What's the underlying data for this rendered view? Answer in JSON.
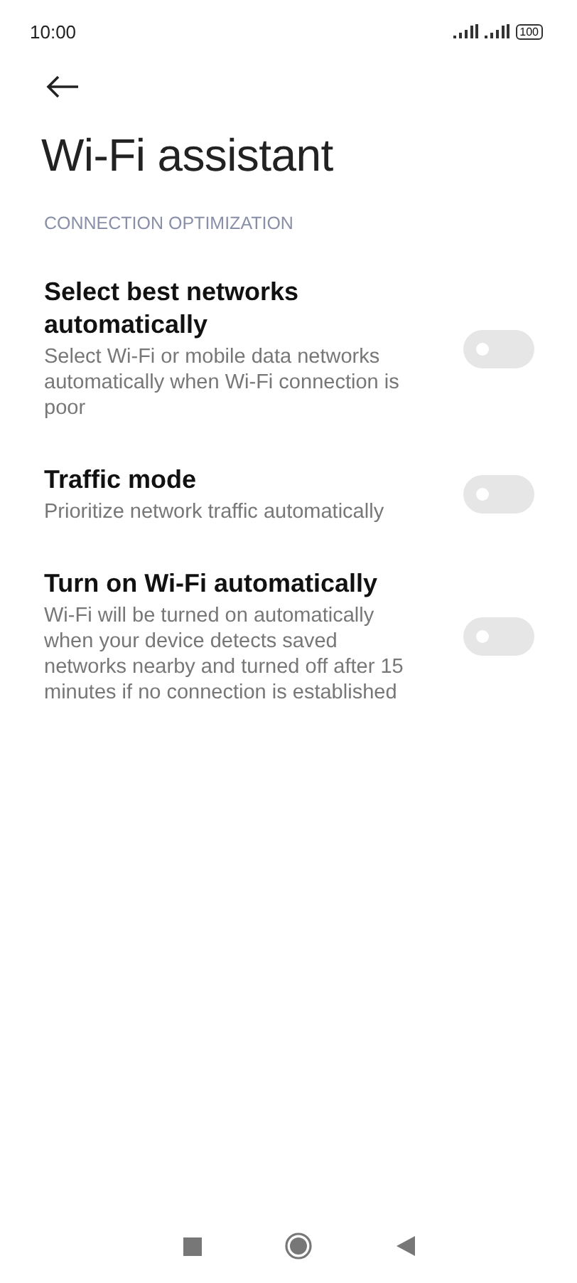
{
  "status_bar": {
    "time": "10:00",
    "battery": "100"
  },
  "title": "Wi-Fi assistant",
  "section": "CONNECTION OPTIMIZATION",
  "settings": [
    {
      "title": "Select best networks automatically",
      "description": "Select Wi-Fi or mobile data networks automatically when Wi-Fi connection is poor",
      "on": false
    },
    {
      "title": "Traffic mode",
      "description": "Prioritize network traffic automatically",
      "on": false
    },
    {
      "title": "Turn on Wi-Fi automatically",
      "description": "Wi-Fi will be turned on automatically when your device detects saved networks nearby and turned off after 15 minutes if no connection is established",
      "on": false
    }
  ]
}
